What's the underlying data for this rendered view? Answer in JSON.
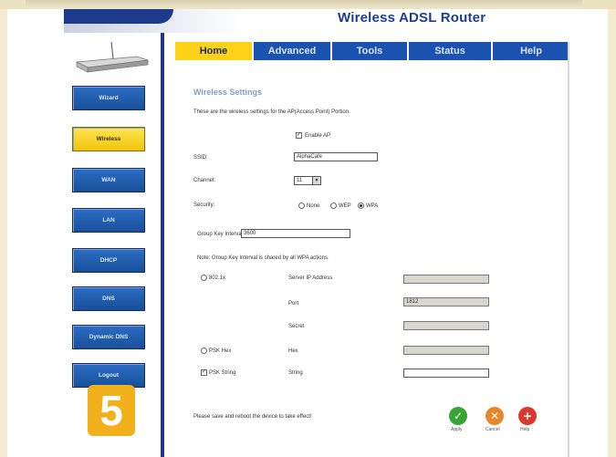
{
  "header": {
    "product_title": "Wireless ADSL Router"
  },
  "tabs": [
    {
      "label": "Home",
      "active": true
    },
    {
      "label": "Advanced",
      "active": false
    },
    {
      "label": "Tools",
      "active": false
    },
    {
      "label": "Status",
      "active": false
    },
    {
      "label": "Help",
      "active": false
    }
  ],
  "sidebar": {
    "items": [
      {
        "label": "Wizard",
        "active": false
      },
      {
        "label": "Wireless",
        "active": true
      },
      {
        "label": "WAN",
        "active": false
      },
      {
        "label": "LAN",
        "active": false
      },
      {
        "label": "DHCP",
        "active": false
      },
      {
        "label": "DNS",
        "active": false
      },
      {
        "label": "Dynamic DNS",
        "active": false
      },
      {
        "label": "Logout",
        "active": false
      }
    ]
  },
  "step_badge": "5",
  "wireless": {
    "title": "Wireless Settings",
    "intro": "These are the wireless settings for the AP(Access Point) Portion.",
    "enable_ap_label": "Enable AP",
    "enable_ap_checked": true,
    "ssid_label": "SSID:",
    "ssid_value": "AlphaCafe",
    "channel_label": "Channel:",
    "channel_value": "11",
    "security_label": "Security:",
    "security_options": [
      "None",
      "WEP",
      "WPA"
    ],
    "security_selected": "WPA",
    "group_key_label": "Group Key Interval:",
    "group_key_value": "3600",
    "note": "Note: Group Key Interval is shared by all WPA actions.",
    "auth_8021x_label": "802.1x",
    "radius_ip_label": "Server IP Address",
    "radius_ip_value": "",
    "port_label": "Port",
    "port_value": "1812",
    "secret_label": "Secret",
    "secret_value": "",
    "psk_hex_label": "PSK Hex",
    "hex_label": "Hex",
    "hex_value": "",
    "psk_string_label": "PSK String",
    "psk_string_checked": true,
    "string_label": "String",
    "string_value": "",
    "footer_note": "Please save and reboot the device to take effect!"
  },
  "actions": [
    {
      "label": "Apply",
      "icon": "check-icon",
      "color": "#3aa335"
    },
    {
      "label": "Cancel",
      "icon": "x-icon",
      "color": "#e8872a"
    },
    {
      "label": "Help",
      "icon": "plus-icon",
      "color": "#d93a2b"
    }
  ],
  "colors": {
    "accent_blue": "#1a52b0",
    "active_yellow": "#ffd21a",
    "badge_orange": "#f2b01c"
  }
}
